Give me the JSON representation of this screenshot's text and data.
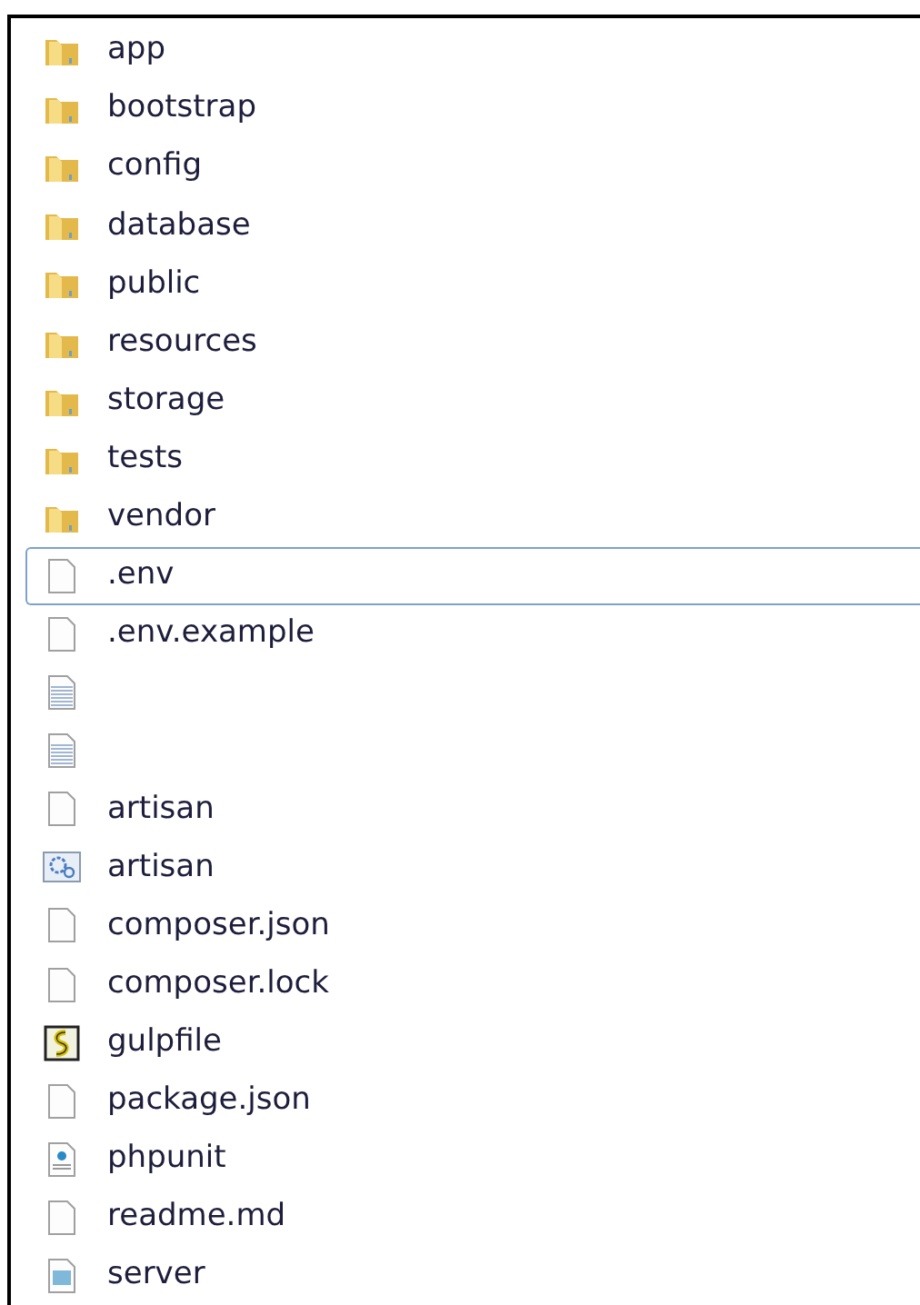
{
  "files": [
    {
      "name": "app",
      "kind": "folder",
      "selected": false
    },
    {
      "name": "bootstrap",
      "kind": "folder",
      "selected": false
    },
    {
      "name": "config",
      "kind": "folder",
      "selected": false
    },
    {
      "name": "database",
      "kind": "folder",
      "selected": false
    },
    {
      "name": "public",
      "kind": "folder",
      "selected": false
    },
    {
      "name": "resources",
      "kind": "folder",
      "selected": false
    },
    {
      "name": "storage",
      "kind": "folder",
      "selected": false
    },
    {
      "name": "tests",
      "kind": "folder",
      "selected": false
    },
    {
      "name": "vendor",
      "kind": "folder",
      "selected": false
    },
    {
      "name": ".env",
      "kind": "file",
      "selected": true
    },
    {
      "name": ".env.example",
      "kind": "file",
      "selected": false
    },
    {
      "kind": "text",
      "selected": false
    },
    {
      "kind": "text",
      "selected": false
    },
    {
      "name": "artisan",
      "kind": "file",
      "selected": false
    },
    {
      "name": "artisan",
      "kind": "gear",
      "selected": false
    },
    {
      "name": "composer.json",
      "kind": "file",
      "selected": false
    },
    {
      "name": "composer.lock",
      "kind": "file",
      "selected": false
    },
    {
      "name": "gulpfile",
      "kind": "script",
      "selected": false
    },
    {
      "name": "package.json",
      "kind": "file",
      "selected": false
    },
    {
      "name": "phpunit",
      "kind": "xml",
      "selected": false
    },
    {
      "name": "readme.md",
      "kind": "file",
      "selected": false
    },
    {
      "name": "server",
      "kind": "window",
      "selected": false
    }
  ]
}
